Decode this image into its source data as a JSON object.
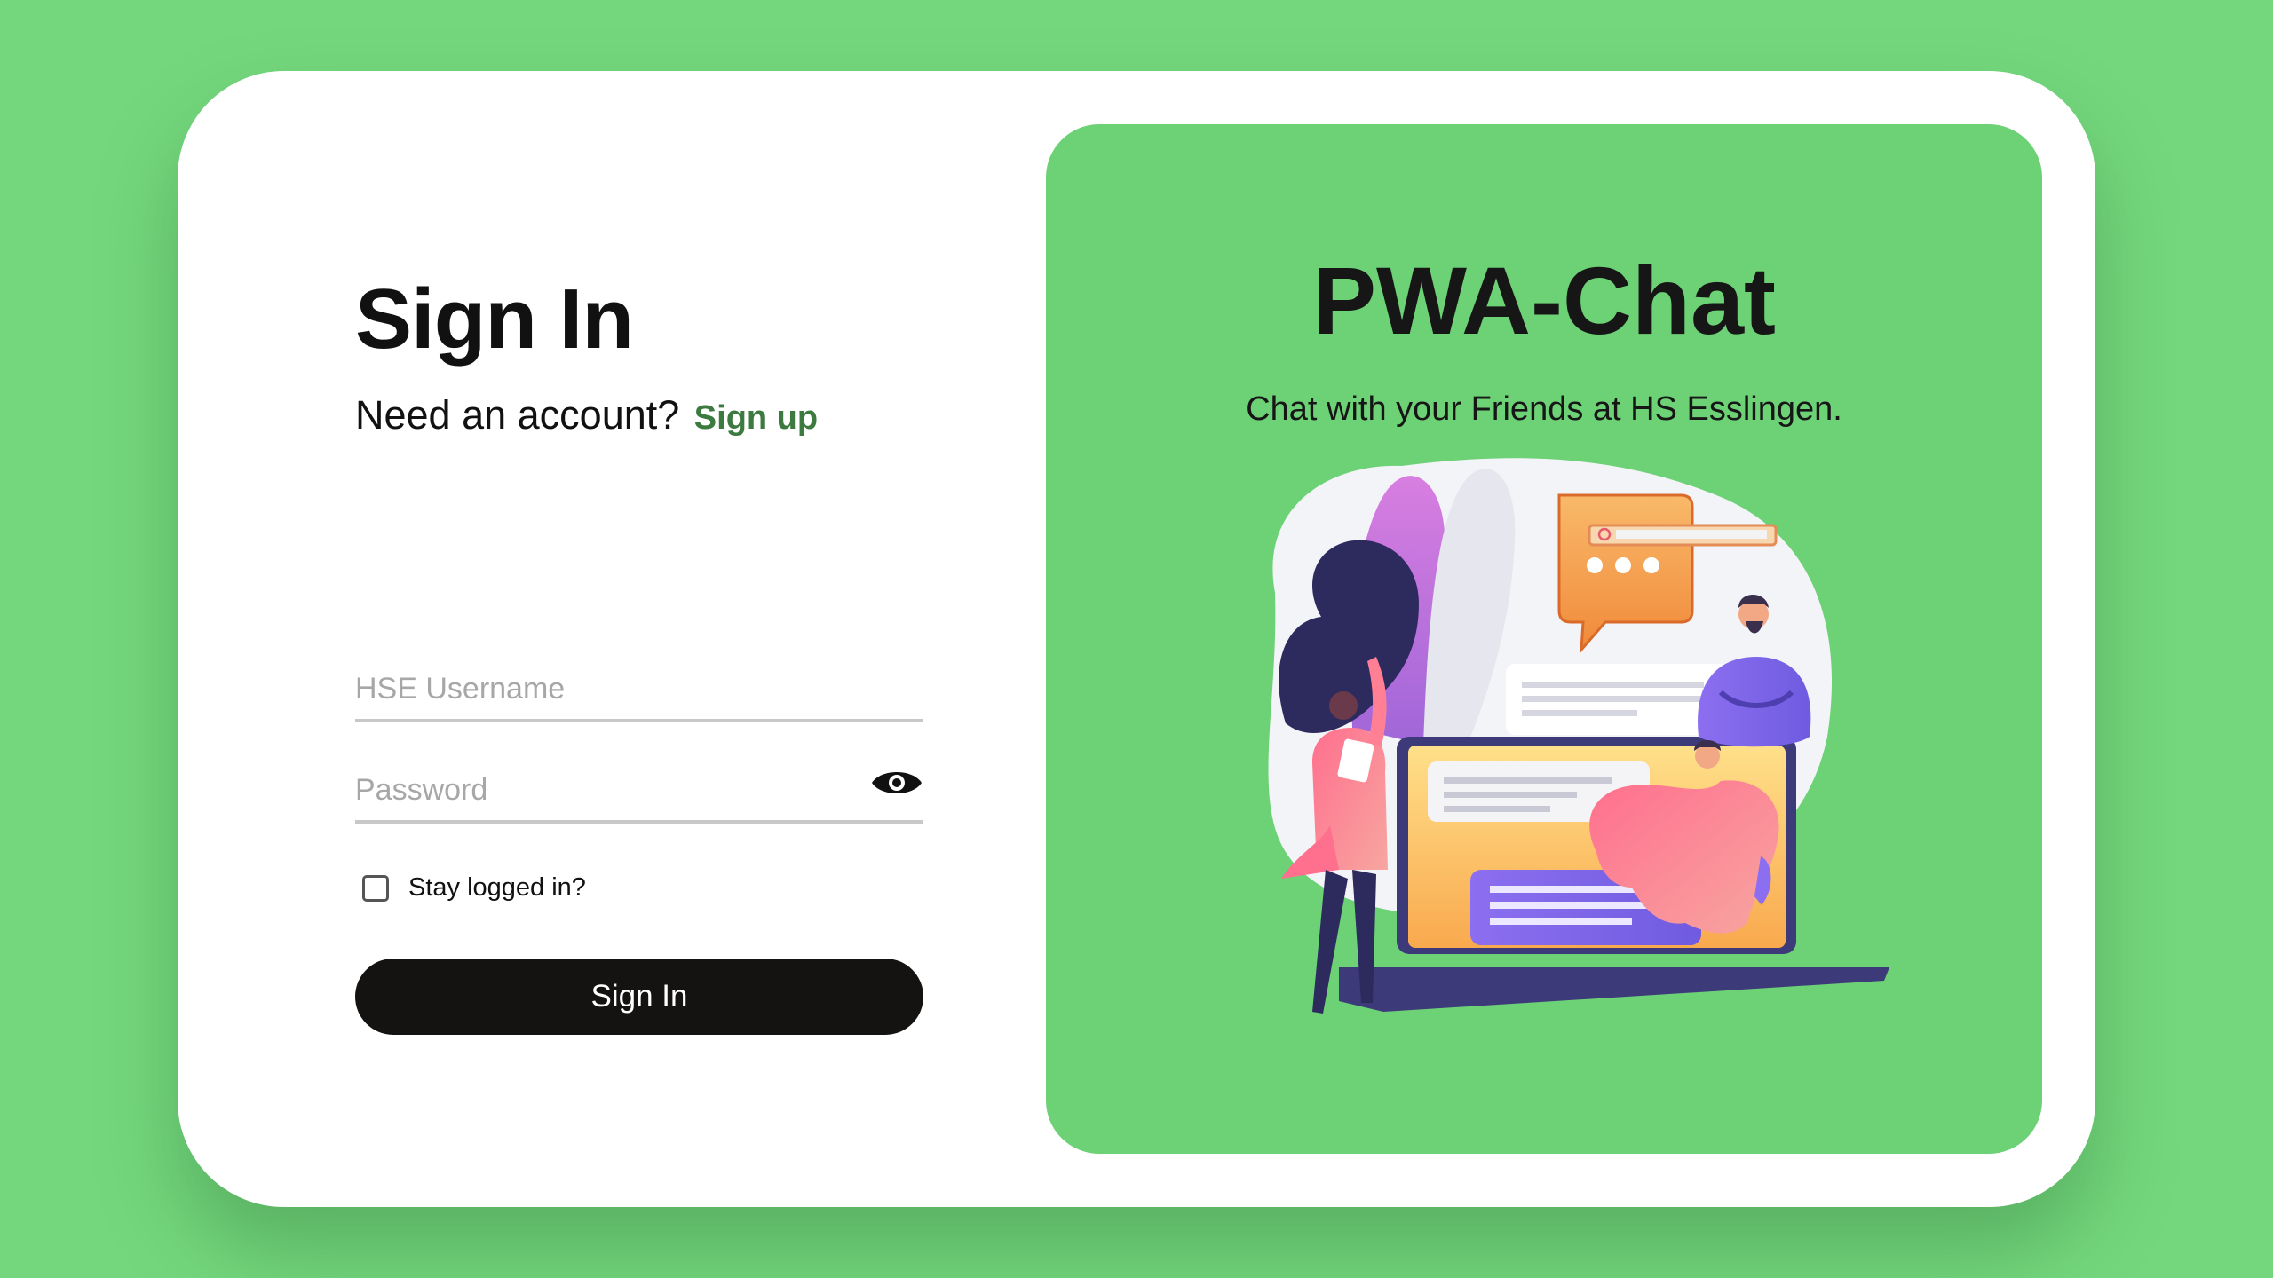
{
  "login": {
    "title": "Sign In",
    "need_account": "Need an account?",
    "signup_link": "Sign up",
    "username_placeholder": "HSE Username",
    "username_value": "",
    "password_placeholder": "Password",
    "password_value": "",
    "password_toggle_icon": "eye-icon",
    "stay_logged_in_label": "Stay logged in?",
    "stay_logged_in_checked": false,
    "submit_label": "Sign In"
  },
  "promo": {
    "app_name": "PWA-Chat",
    "tagline": "Chat with your Friends at HS Esslingen."
  },
  "colors": {
    "page_background": "#74d77d",
    "card_background": "#ffffff",
    "promo_background": "#6dd176",
    "link_green": "#3c7a3f",
    "button_background": "#151212"
  }
}
